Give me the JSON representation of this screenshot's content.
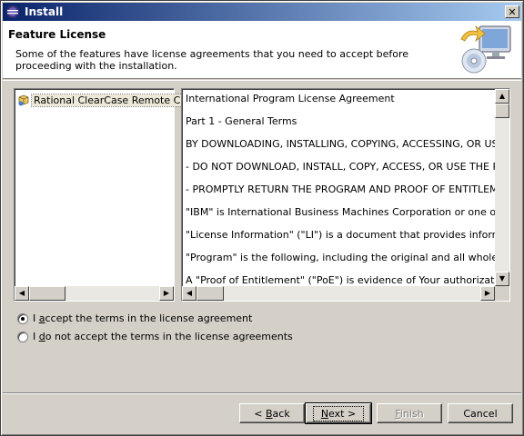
{
  "window": {
    "title": "Install",
    "close_glyph": "✕"
  },
  "banner": {
    "title": "Feature License",
    "description": "Some of the features have license agreements that you need to accept before proceeding with the installation.",
    "icon": "install-cd-monitor-icon"
  },
  "features": [
    {
      "label": "Rational ClearCase Remote Client",
      "icon": "feature-package-icon"
    }
  ],
  "license": {
    "lines": [
      "International Program License Agreement",
      "Part 1 - General Terms",
      "BY DOWNLOADING, INSTALLING, COPYING, ACCESSING, OR USING THE",
      "- DO NOT DOWNLOAD, INSTALL, COPY, ACCESS, OR USE THE PROGRAM",
      "- PROMPTLY RETURN THE PROGRAM AND PROOF OF ENTITLEMENT TO T",
      "\"IBM\" is International Business Machines Corporation or one of its subsidia",
      "\"License Information\" (\"LI\") is a document that provides information specif",
      "\"Program\" is the following, including the original and all whole or partial co",
      "A \"Proof of Entitlement\" (\"PoE\") is evidence of Your authorization to use a"
    ]
  },
  "options": {
    "accept": {
      "pre": "I ",
      "ul": "a",
      "post": "ccept the terms in the license agreement",
      "selected": true
    },
    "decline": {
      "pre": "I ",
      "ul": "d",
      "post": "o not accept the terms in the license agreements",
      "selected": false
    }
  },
  "buttons": {
    "back": {
      "pre": "< ",
      "ul": "B",
      "post": "ack"
    },
    "next": {
      "pre": "",
      "ul": "N",
      "post": "ext >"
    },
    "finish": {
      "pre": "",
      "ul": "F",
      "post": "inish",
      "disabled": true
    },
    "cancel": {
      "label": "Cancel"
    }
  },
  "colors": {
    "titlebar_start": "#0a246a",
    "titlebar_end": "#a6caf0",
    "dialog_face": "#d4d0c8",
    "disabled_text": "#808080"
  }
}
